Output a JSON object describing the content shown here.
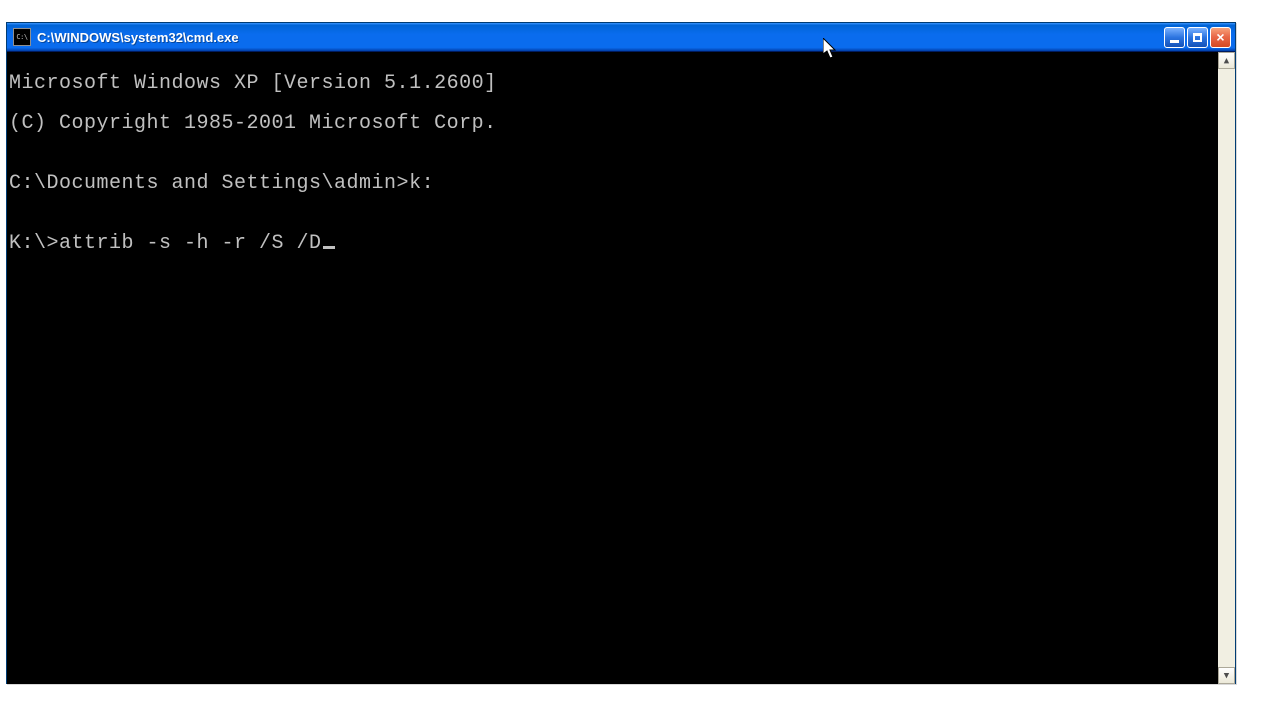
{
  "window": {
    "title": "C:\\WINDOWS\\system32\\cmd.exe",
    "icon_label": "C:\\"
  },
  "terminal": {
    "lines": [
      "Microsoft Windows XP [Version 5.1.2600]",
      "(C) Copyright 1985-2001 Microsoft Corp.",
      "",
      "C:\\Documents and Settings\\admin>k:",
      "",
      "K:\\>attrib -s -h -r /S /D"
    ]
  }
}
